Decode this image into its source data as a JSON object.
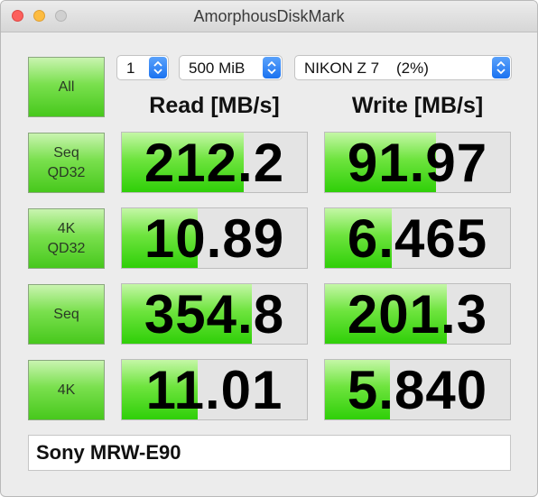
{
  "window": {
    "title": "AmorphousDiskMark"
  },
  "controls": {
    "all_label": "All",
    "count_value": "1",
    "size_value": "500 MiB",
    "drive_value": "NIKON Z 7    (2%)"
  },
  "headers": {
    "read": "Read [MB/s]",
    "write": "Write [MB/s]"
  },
  "tests": [
    {
      "label": "Seq\nQD32",
      "read": "212.2",
      "write": "91.97",
      "read_fill": 0.66,
      "write_fill": 0.6
    },
    {
      "label": "4K\nQD32",
      "read": "10.89",
      "write": "6.465",
      "read_fill": 0.41,
      "write_fill": 0.36
    },
    {
      "label": "Seq",
      "read": "354.8",
      "write": "201.3",
      "read_fill": 0.7,
      "write_fill": 0.66
    },
    {
      "label": "4K",
      "read": "11.01",
      "write": "5.840",
      "read_fill": 0.41,
      "write_fill": 0.35
    }
  ],
  "comment": "Sony MRW-E90",
  "colors": {
    "accent_blue": "#1a72f0",
    "bar_green": "#2fcf08",
    "traffic_close": "#fc605c",
    "traffic_min": "#fdbc40"
  }
}
